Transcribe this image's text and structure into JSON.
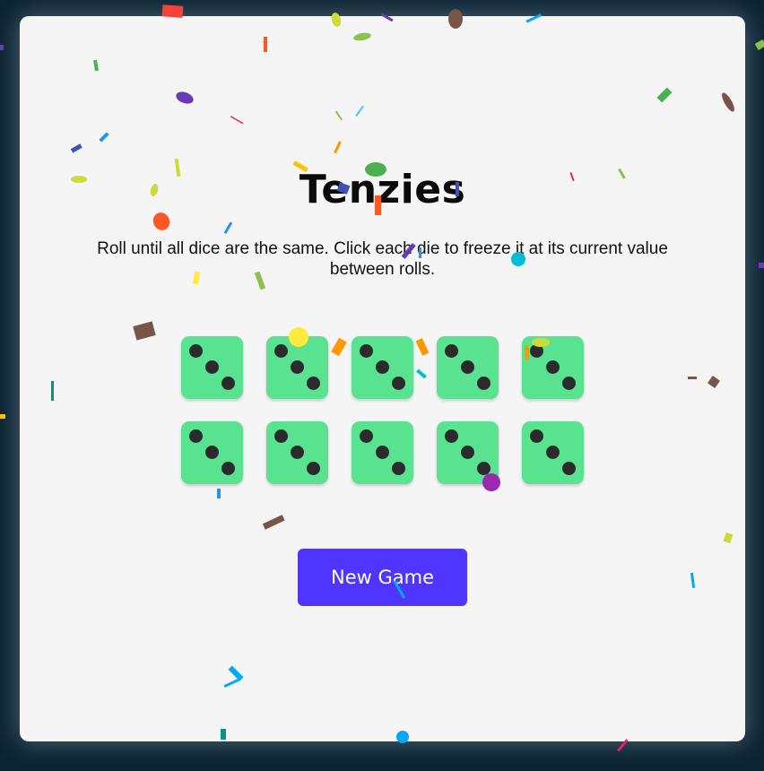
{
  "game": {
    "title": "Tenzies",
    "instructions": "Roll until all dice are the same. Click each die to freeze it at its current value between rolls.",
    "new_game_label": "New Game"
  },
  "dice": [
    {
      "value": 3,
      "held": false
    },
    {
      "value": 3,
      "held": false
    },
    {
      "value": 3,
      "held": false
    },
    {
      "value": 3,
      "held": false
    },
    {
      "value": 3,
      "held": false
    },
    {
      "value": 3,
      "held": false
    },
    {
      "value": 3,
      "held": false
    },
    {
      "value": 3,
      "held": false
    },
    {
      "value": 3,
      "held": false
    },
    {
      "value": 3,
      "held": false
    }
  ],
  "colors": {
    "background": "#0b2434",
    "board": "#f5f5f5",
    "die_face": "#59e391",
    "pip": "#2b2b2b",
    "button": "#5035ff",
    "button_text": "#ffffff"
  },
  "confetti_visible": true
}
